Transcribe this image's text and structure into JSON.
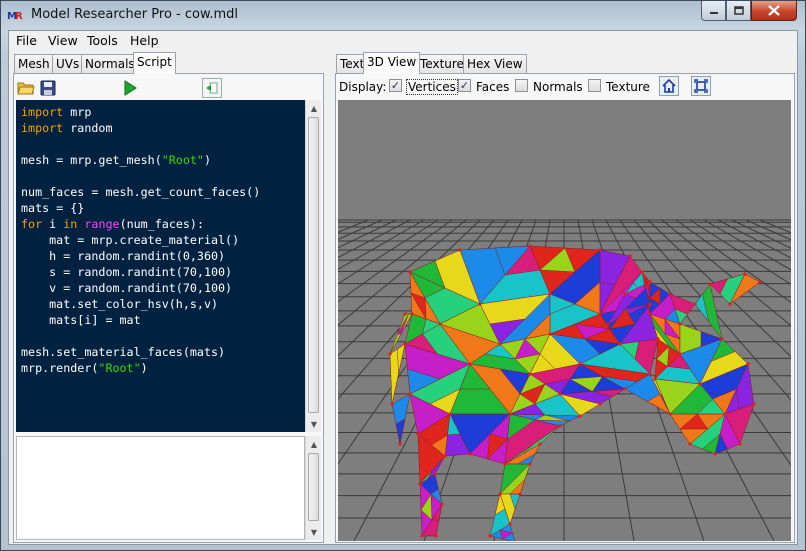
{
  "window": {
    "title": "Model Researcher Pro - cow.mdl",
    "icon": "mr-logo-icon",
    "controls": [
      "minimize-icon",
      "maximize-icon",
      "close-icon"
    ]
  },
  "menu": {
    "items": [
      {
        "label": "File"
      },
      {
        "label": "View"
      },
      {
        "label": "Tools"
      },
      {
        "label": "Help"
      }
    ]
  },
  "left_tabs": [
    {
      "label": "Mesh"
    },
    {
      "label": "UVs"
    },
    {
      "label": "Normals"
    },
    {
      "label": "Script",
      "active": true
    }
  ],
  "script_toolbar": [
    "open-folder-icon",
    "save-disk-icon",
    "run-play-icon",
    "export-icon"
  ],
  "script_lines": [
    [
      {
        "t": "import",
        "c": "kw"
      },
      {
        "t": " mrp"
      }
    ],
    [
      {
        "t": "import",
        "c": "kw"
      },
      {
        "t": " random"
      }
    ],
    [],
    [
      {
        "t": "mesh = mrp.get_mesh("
      },
      {
        "t": "\"Root\"",
        "c": "st"
      },
      {
        "t": ")"
      }
    ],
    [],
    [
      {
        "t": "num_faces = mesh.get_count_faces()"
      }
    ],
    [
      {
        "t": "mats = {}"
      }
    ],
    [
      {
        "t": "for",
        "c": "kw"
      },
      {
        "t": " i "
      },
      {
        "t": "in",
        "c": "kw"
      },
      {
        "t": " "
      },
      {
        "t": "range",
        "c": "bi"
      },
      {
        "t": "(num_faces):"
      }
    ],
    [
      {
        "t": "    mat = mrp.create_material()"
      }
    ],
    [
      {
        "t": "    h = random.randint(0,360)"
      }
    ],
    [
      {
        "t": "    s = random.randint(70,100)"
      }
    ],
    [
      {
        "t": "    v = random.randint(70,100)"
      }
    ],
    [
      {
        "t": "    mat.set_color_hsv(h,s,v)"
      }
    ],
    [
      {
        "t": "    mats[i] = mat"
      }
    ],
    [],
    [
      {
        "t": "mesh.set_material_faces(mats)"
      }
    ],
    [
      {
        "t": "mrp.render("
      },
      {
        "t": "\"Root\"",
        "c": "st"
      },
      {
        "t": ")"
      }
    ]
  ],
  "right_tabs": [
    {
      "label": "Text"
    },
    {
      "label": "3D View",
      "active": true
    },
    {
      "label": "Texture"
    },
    {
      "label": "Hex View"
    }
  ],
  "display": {
    "label": "Display:",
    "options": [
      {
        "label": "Vertices",
        "checked": true
      },
      {
        "label": "Faces",
        "checked": true
      },
      {
        "label": "Normals",
        "checked": false
      },
      {
        "label": "Texture",
        "checked": false
      }
    ],
    "buttons": [
      "home-view-icon",
      "fit-view-icon"
    ]
  },
  "viewport": {
    "background": "#7e7e7e",
    "grid_color": "#3a3a3a",
    "model": "cow",
    "face_colors": [
      "#e0261c",
      "#20b838",
      "#1e3cd8",
      "#e8d81a",
      "#c61ec8",
      "#18c4c8",
      "#f07818",
      "#8a24e0",
      "#9ad41a",
      "#d81e78",
      "#1c8ae8",
      "#26d07c"
    ]
  }
}
